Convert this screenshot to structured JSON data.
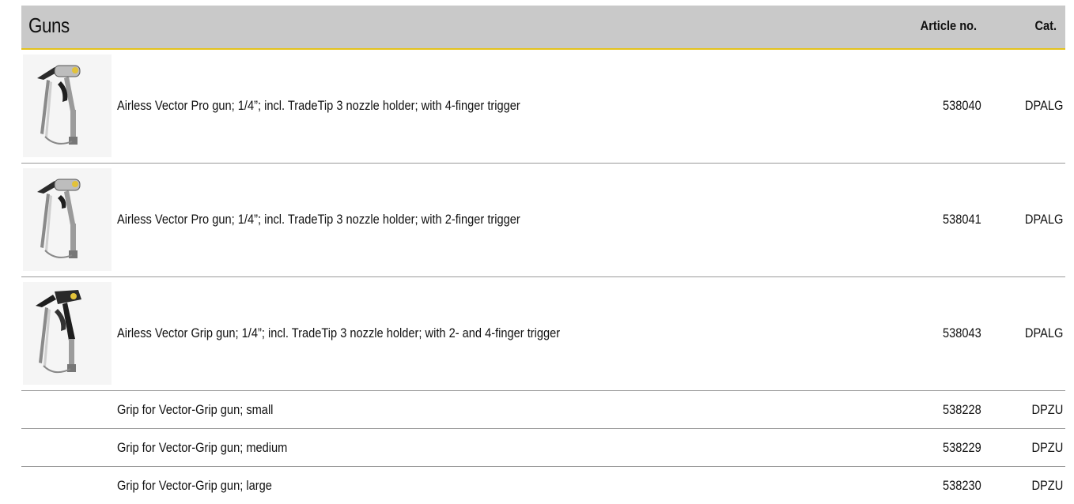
{
  "header": {
    "title": "Guns",
    "article_label": "Article no.",
    "cat_label": "Cat."
  },
  "rows": [
    {
      "image": "spray-gun-4-finger-icon",
      "description": "Airless Vector Pro gun; 1/4”; incl. TradeTip 3 nozzle holder; with 4-finger trigger",
      "article": "538040",
      "cat": "DPALG"
    },
    {
      "image": "spray-gun-2-finger-icon",
      "description": "Airless Vector Pro gun; 1/4”; incl. TradeTip 3 nozzle holder; with 2-finger trigger",
      "article": "538041",
      "cat": "DPALG"
    },
    {
      "image": "spray-gun-grip-icon",
      "description": "Airless Vector Grip gun; 1/4”; incl. TradeTip 3 nozzle holder; with 2- and 4-finger trigger",
      "article": "538043",
      "cat": "DPALG"
    },
    {
      "description": "Grip for Vector-Grip gun; small",
      "article": "538228",
      "cat": "DPZU"
    },
    {
      "description": "Grip for Vector-Grip gun; medium",
      "article": "538229",
      "cat": "DPZU"
    },
    {
      "description": "Grip for Vector-Grip gun; large",
      "article": "538230",
      "cat": "DPZU"
    }
  ]
}
